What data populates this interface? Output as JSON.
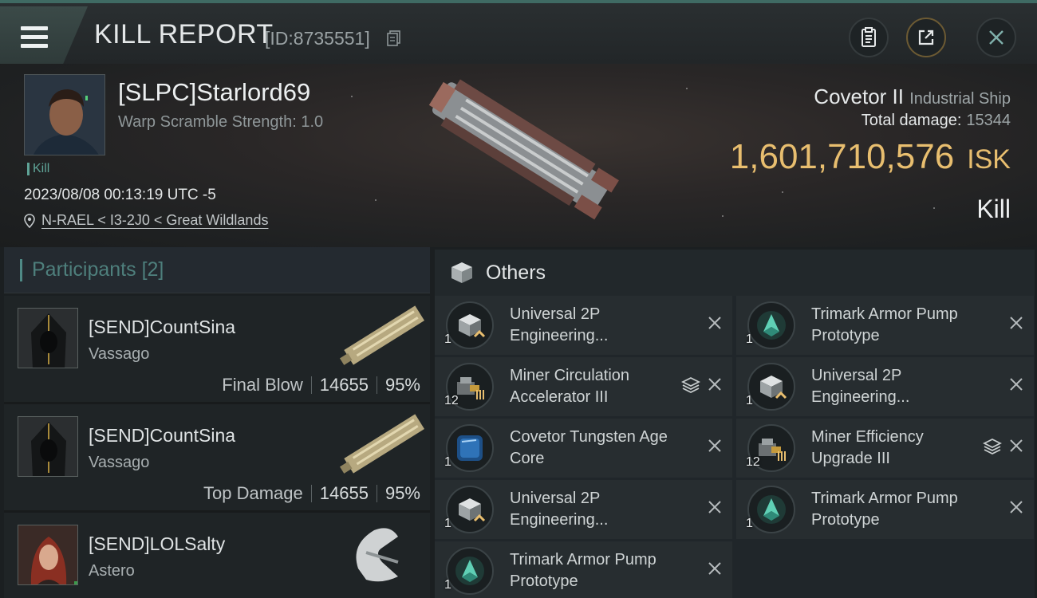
{
  "header": {
    "title": "KILL REPORT",
    "report_id": "[ID:8735551]"
  },
  "victim": {
    "pilot_name": "[SLPC]Starlord69",
    "warp_scramble": "Warp Scramble Strength: 1.0",
    "tag": "Kill",
    "timestamp": "2023/08/08 00:13:19 UTC -5",
    "location": "N-RAEL < I3-2J0 < Great Wildlands",
    "ship_name": "Covetor II",
    "ship_class": "Industrial Ship",
    "total_damage_label": "Total damage:",
    "total_damage_value": "15344",
    "isk_value": "1,601,710,576",
    "isk_unit": "ISK",
    "result": "Kill"
  },
  "participants": {
    "label": "Participants",
    "count": "[2]",
    "rows": [
      {
        "name": "[SEND]CountSina",
        "ship": "Vassago",
        "role": "Final Blow",
        "damage": "14655",
        "percent": "95%"
      },
      {
        "name": "[SEND]CountSina",
        "ship": "Vassago",
        "role": "Top Damage",
        "damage": "14655",
        "percent": "95%"
      },
      {
        "name": "[SEND]LOLSalty",
        "ship": "Astero"
      }
    ]
  },
  "others": {
    "label": "Others",
    "items": [
      {
        "qty": "1",
        "name": "Universal 2P Engineering...",
        "icon": "engineering-module-icon"
      },
      {
        "qty": "1",
        "name": "Trimark Armor Pump Prototype",
        "icon": "armor-rig-icon"
      },
      {
        "qty": "12",
        "name": "Miner Circulation Accelerator III",
        "icon": "mining-module-icon",
        "stack": true
      },
      {
        "qty": "1",
        "name": "Universal 2P Engineering...",
        "icon": "engineering-module-icon"
      },
      {
        "qty": "1",
        "name": "Covetor Tungsten Age Core",
        "icon": "core-icon"
      },
      {
        "qty": "12",
        "name": "Miner Efficiency Upgrade III",
        "icon": "mining-module-icon",
        "stack": true
      },
      {
        "qty": "1",
        "name": "Universal 2P Engineering...",
        "icon": "engineering-module-icon"
      },
      {
        "qty": "1",
        "name": "Trimark Armor Pump Prototype",
        "icon": "armor-rig-icon"
      },
      {
        "qty": "1",
        "name": "Trimark Armor Pump Prototype",
        "icon": "armor-rig-icon"
      }
    ]
  },
  "colors": {
    "accent_teal": "#4f8a86",
    "isk_gold": "#e8be6f",
    "background": "#1b1f21"
  }
}
